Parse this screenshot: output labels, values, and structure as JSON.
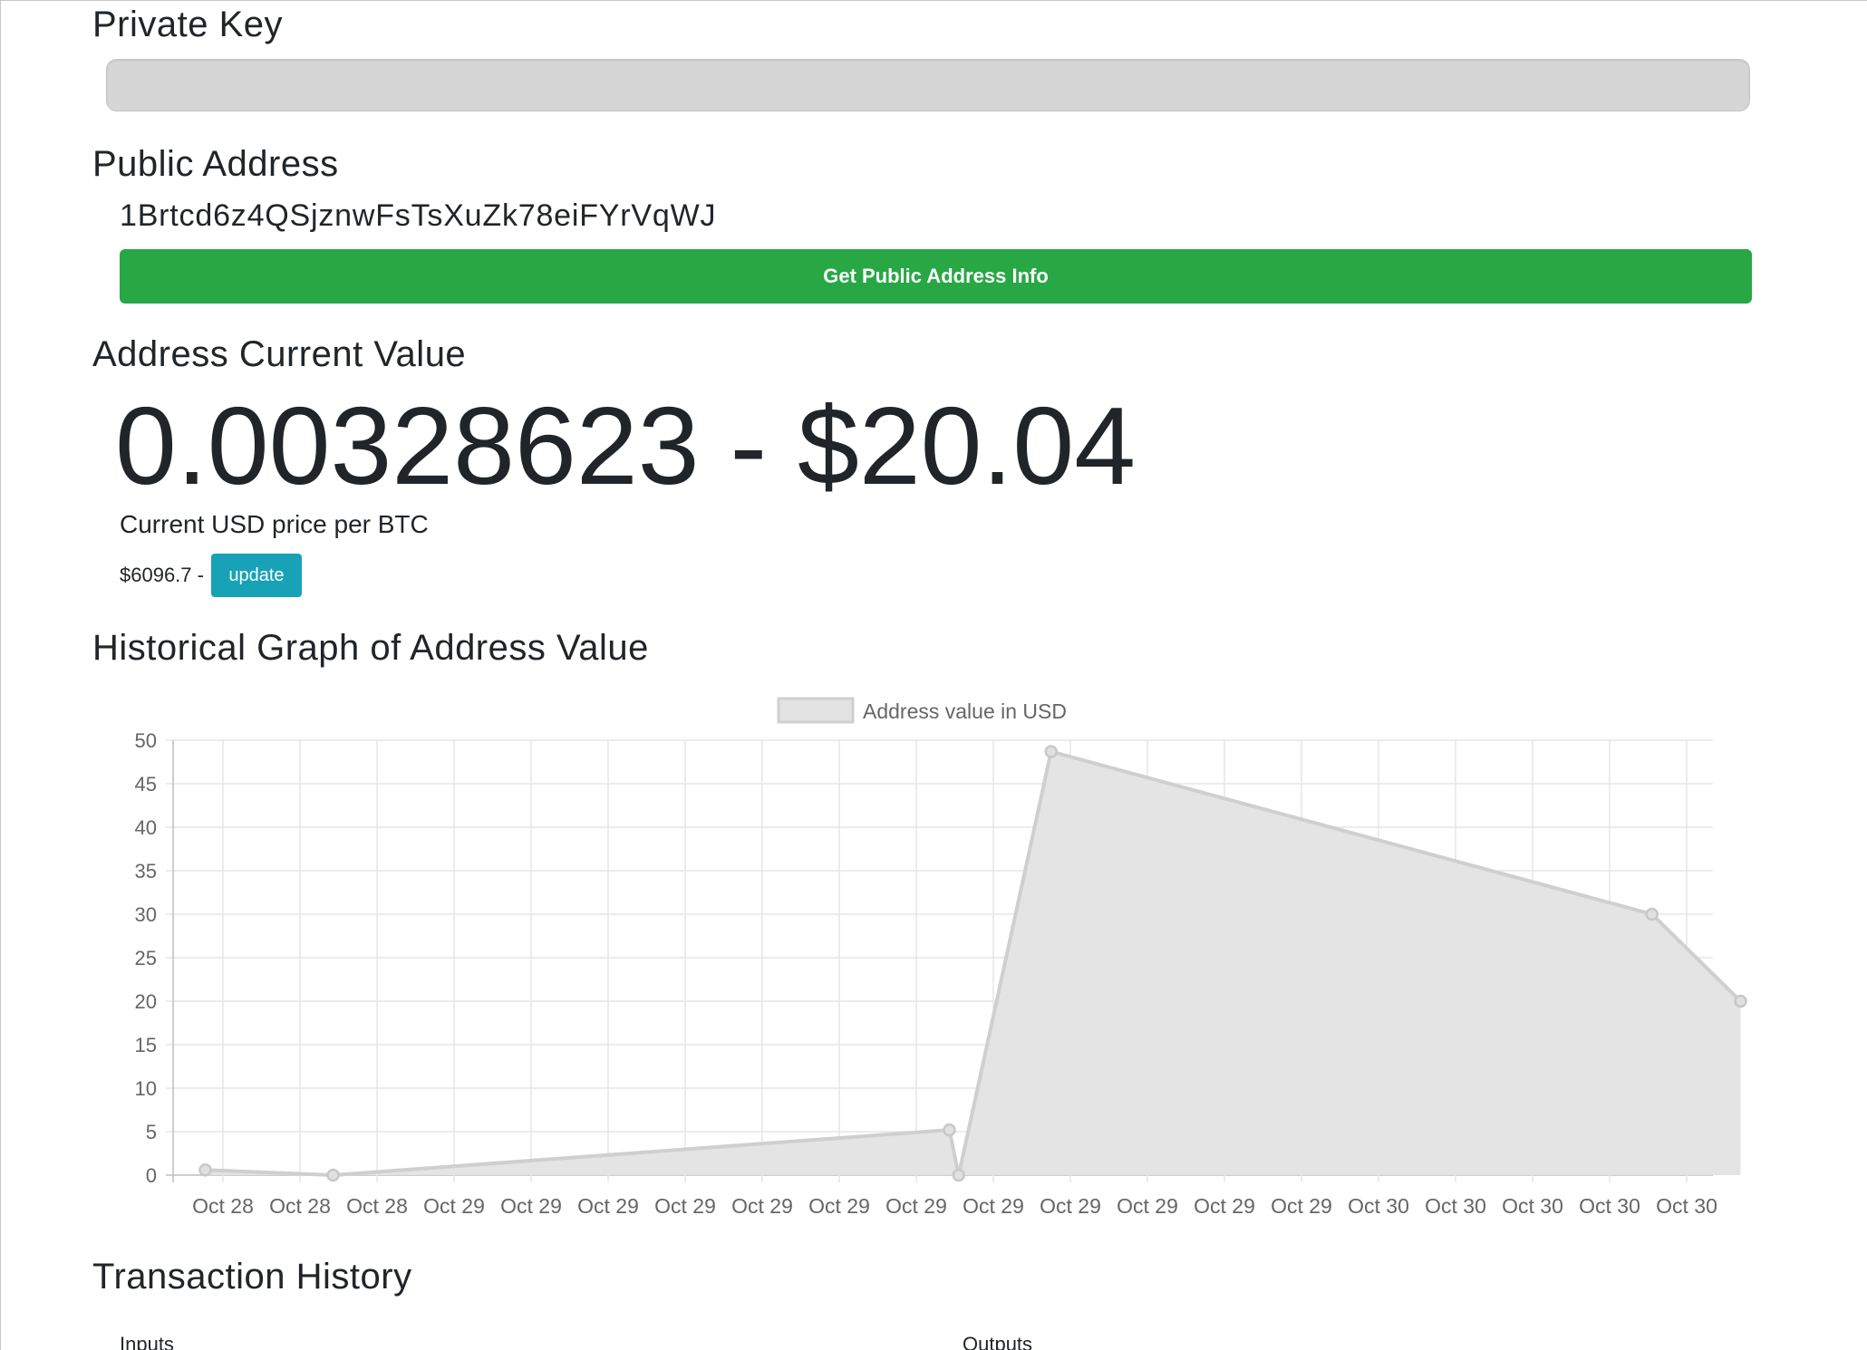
{
  "private_key": {
    "heading": "Private Key",
    "value": ""
  },
  "public_address": {
    "heading": "Public Address",
    "address": "1Brtcd6z4QSjznwFsTsXuZk78eiFYrVqWJ",
    "button_label": "Get Public Address Info"
  },
  "current_value": {
    "heading": "Address Current Value",
    "value_text": "0.00328623 - $20.04",
    "price_label": "Current USD price per BTC",
    "price_text": "$6096.7 -",
    "update_label": "update"
  },
  "graph": {
    "heading": "Historical Graph of Address Value"
  },
  "transactions": {
    "heading": "Transaction History",
    "inputs_label": "Inputs",
    "outputs_label": "Outputs"
  },
  "colors": {
    "green_button": "#28a745",
    "update_button": "#17a2b8",
    "chart_fill": "#e3e3e3",
    "chart_line": "#cfcfcf"
  },
  "chart_data": {
    "type": "area",
    "legend": "Address value in USD",
    "legend_position": "top",
    "grid": true,
    "ylim": [
      0,
      50
    ],
    "y_ticks": [
      0,
      5,
      10,
      15,
      20,
      25,
      30,
      35,
      40,
      45,
      50
    ],
    "x_tick_labels": [
      "Oct 28",
      "Oct 28",
      "Oct 28",
      "Oct 29",
      "Oct 29",
      "Oct 29",
      "Oct 29",
      "Oct 29",
      "Oct 29",
      "Oct 29",
      "Oct 29",
      "Oct 29",
      "Oct 29",
      "Oct 29",
      "Oct 29",
      "Oct 30",
      "Oct 30",
      "Oct 30",
      "Oct 30",
      "Oct 30"
    ],
    "x_range_ticks": [
      -0.23,
      19.7
    ],
    "series": [
      {
        "name": "Address value in USD",
        "points": [
          {
            "x": -0.23,
            "y": 0.6
          },
          {
            "x": 1.43,
            "y": 0.0
          },
          {
            "x": 9.43,
            "y": 5.2
          },
          {
            "x": 9.55,
            "y": 0.0
          },
          {
            "x": 10.75,
            "y": 48.7
          },
          {
            "x": 18.55,
            "y": 30.0
          },
          {
            "x": 19.7,
            "y": 20.0
          }
        ]
      }
    ]
  }
}
